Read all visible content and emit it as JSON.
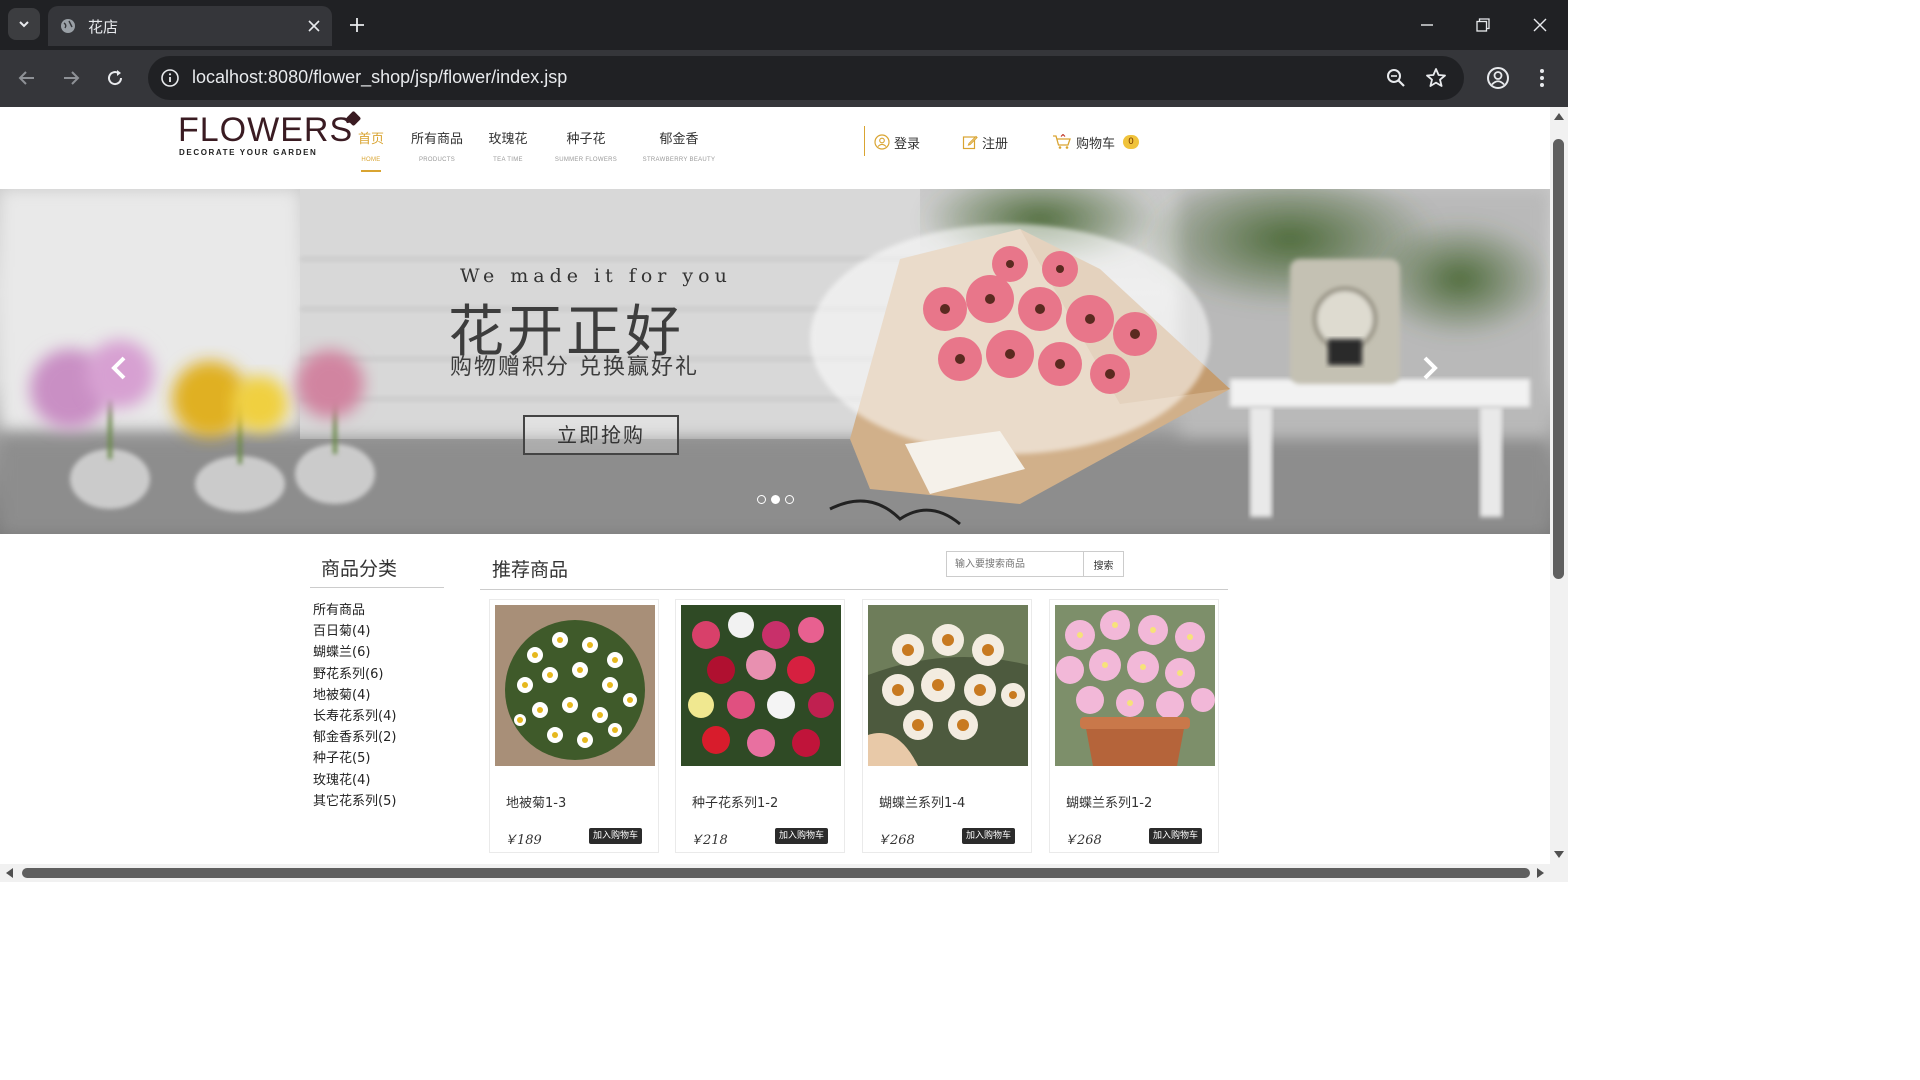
{
  "browser": {
    "tab_title": "花店",
    "url": "localhost:8080/flower_shop/jsp/flower/index.jsp"
  },
  "site": {
    "logo_text": "FLOWERS",
    "logo_tagline": "DECORATE YOUR GARDEN",
    "accent_color": "#d9a431",
    "nav": [
      {
        "label": "首页",
        "sub": "HOME",
        "active": true
      },
      {
        "label": "所有商品",
        "sub": "PRODUCTS",
        "active": false
      },
      {
        "label": "玫瑰花",
        "sub": "TEA TIME",
        "active": false
      },
      {
        "label": "种子花",
        "sub": "SUMMER FLOWERS",
        "active": false
      },
      {
        "label": "郁金香",
        "sub": "STRAWBERRY BEAUTY",
        "active": false
      }
    ],
    "user_nav": {
      "login": "登录",
      "register": "注册",
      "cart": "购物车",
      "cart_count": "0"
    }
  },
  "banner": {
    "tagline": "We made it for you",
    "headline": "花开正好",
    "subtitle": "购物赠积分 兑换赢好礼",
    "cta": "立即抢购",
    "slides": 3,
    "active_slide": 2
  },
  "sidebar": {
    "heading": "商品分类",
    "items": [
      "所有商品",
      "百日菊(4)",
      "蝴蝶兰(6)",
      "野花系列(6)",
      "地被菊(4)",
      "长寿花系列(4)",
      "郁金香系列(2)",
      "种子花(5)",
      "玫瑰花(4)",
      "其它花系列(5)"
    ]
  },
  "recommend": {
    "heading": "推荐商品",
    "search_placeholder": "输入要搜索商品",
    "search_button": "搜索",
    "add_to_cart_label": "加入购物车",
    "products": [
      {
        "name": "地被菊1-3",
        "price": "￥189"
      },
      {
        "name": "种子花系列1-2",
        "price": "￥218"
      },
      {
        "name": "蝴蝶兰系列1-4",
        "price": "￥268"
      },
      {
        "name": "蝴蝶兰系列1-2",
        "price": "￥268"
      }
    ]
  }
}
